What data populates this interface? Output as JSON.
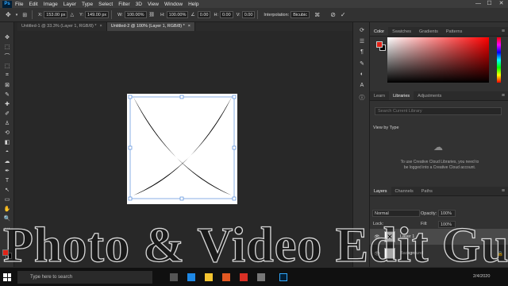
{
  "menubar": {
    "logo": "Ps",
    "items": [
      "File",
      "Edit",
      "Image",
      "Layer",
      "Type",
      "Select",
      "Filter",
      "3D",
      "View",
      "Window",
      "Help"
    ],
    "window_controls": [
      "—",
      "☐",
      "✕"
    ]
  },
  "options": {
    "x_label": "X:",
    "x_value": "153.00 px",
    "y_label": "Y:",
    "y_value": "149.00 px",
    "w_label": "W:",
    "w_value": "100.00%",
    "h_label": "H:",
    "h_value": "100.00%",
    "angle_value": "0.00",
    "hskew_label": "H:",
    "hskew_value": "0.00",
    "vskew_label": "V:",
    "vskew_value": "0.00",
    "interp_label": "Interpolation:",
    "interp_value": "Bicubic"
  },
  "tabs": [
    {
      "label": "Untitled-1 @ 33.3% (Layer 1, RGB/8) *",
      "active": false
    },
    {
      "label": "Untitled-2 @ 100% (Layer 1, RGB/8) *",
      "active": true
    }
  ],
  "tools": [
    "✥",
    "⬚",
    "⌒",
    "⬚",
    "⌗",
    "⊠",
    "✎",
    "✚",
    "✐",
    "♙",
    "⟲",
    "◧",
    "◓",
    "☁",
    "✒",
    "T",
    "↖",
    "▭",
    "✋",
    "🔍",
    "···"
  ],
  "color_panel": {
    "tabs": [
      "Color",
      "Swatches",
      "Gradients",
      "Patterns"
    ],
    "fg_color": "#e22317",
    "bg_color": "#000000"
  },
  "libraries_panel": {
    "tabs": [
      "Learn",
      "Libraries",
      "Adjustments"
    ],
    "search_placeholder": "Search Current Library",
    "view_by": "View by Type",
    "message": "To use Creative Cloud Libraries, you need to be logged into a Creative Cloud account."
  },
  "layers_panel": {
    "tabs": [
      "Layers",
      "Channels",
      "Paths"
    ],
    "kind_label": "Normal",
    "opacity_label": "Opacity:",
    "opacity_value": "100%",
    "lock_label": "Lock:",
    "fill_label": "Fill:",
    "fill_value": "100%",
    "layers": [
      {
        "name": "Layer 1",
        "selected": true
      },
      {
        "name": "Background",
        "selected": false
      }
    ]
  },
  "taskbar": {
    "search_placeholder": "Type here to search",
    "start_icon": "windows-logo",
    "time": "2/4/2020"
  },
  "watermark": {
    "text": "Photo & Video Edit Gurum"
  }
}
